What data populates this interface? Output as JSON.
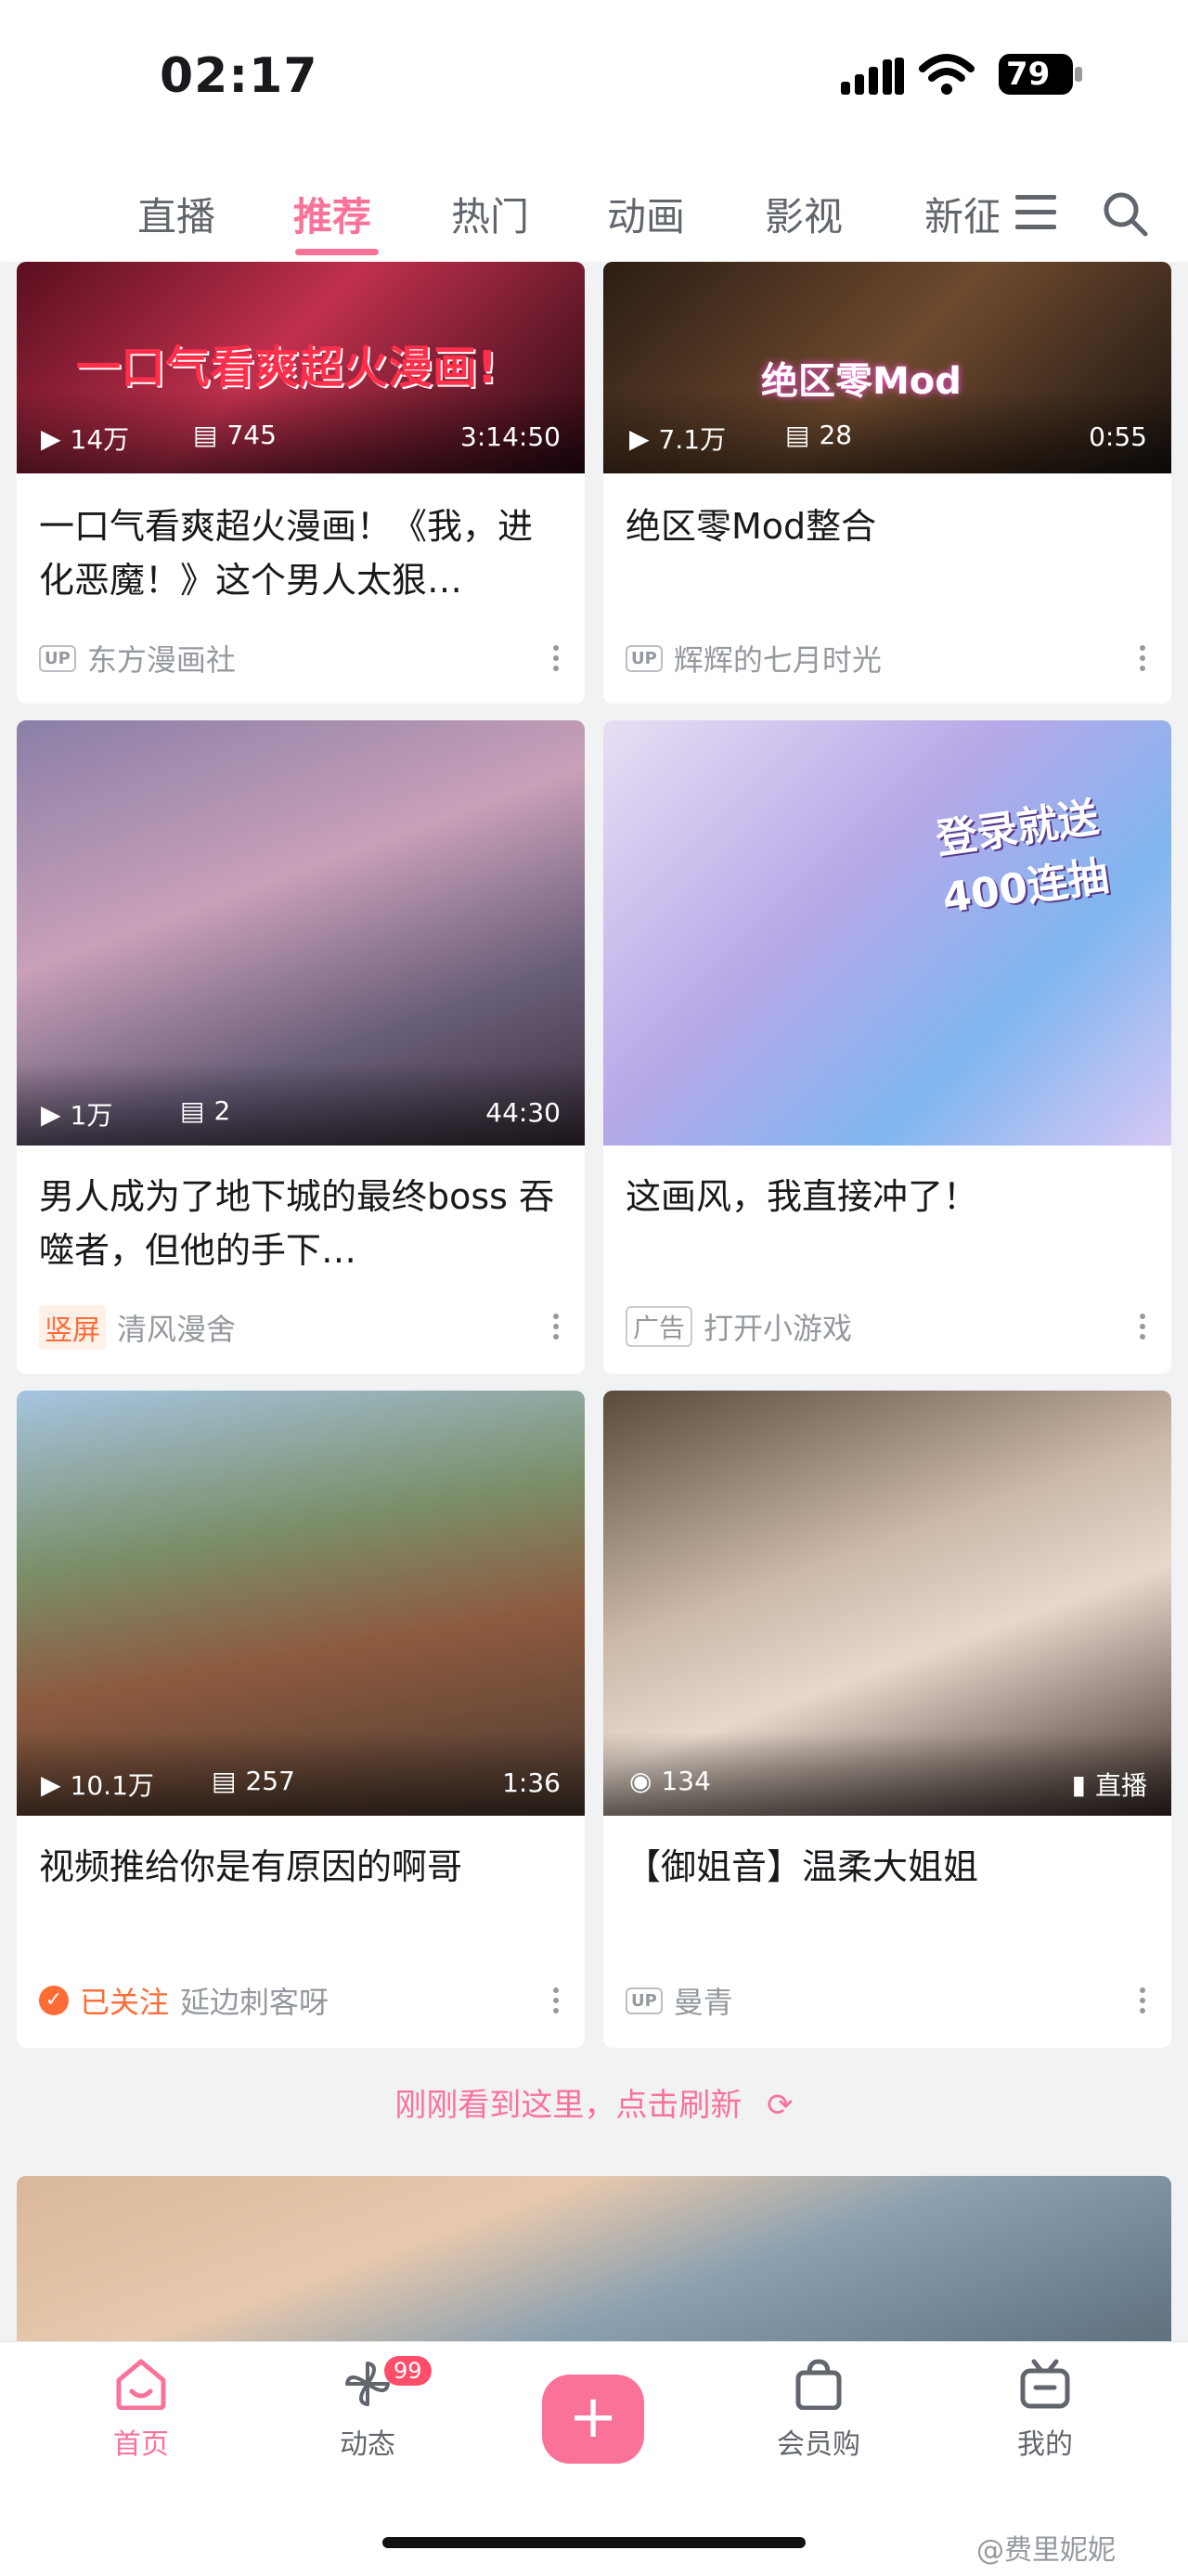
{
  "status": {
    "time": "02:17",
    "battery": "79"
  },
  "tabs": [
    "直播",
    "推荐",
    "热门",
    "动画",
    "影视",
    "新征程"
  ],
  "active_tab": 1,
  "cards": [
    {
      "overlay_text": "一口气看爽超火漫画!",
      "views": "14万",
      "danmaku": "745",
      "duration": "3:14:50",
      "title": "一口气看爽超火漫画！《我，进化恶魔！》这个男人太狠…",
      "badge": "UP",
      "author": "东方漫画社"
    },
    {
      "overlay_text": "绝区零Mod",
      "views": "7.1万",
      "danmaku": "28",
      "duration": "0:55",
      "title": "绝区零Mod整合",
      "badge": "UP",
      "author": "辉辉的七月时光"
    },
    {
      "views": "1万",
      "danmaku": "2",
      "duration": "44:30",
      "title": "男人成为了地下城的最终boss 吞噬者，但他的手下…",
      "badge": "竖屏",
      "author": "清风漫舍"
    },
    {
      "overlay_text": "登录就送 400连抽",
      "title": "这画风，我直接冲了！",
      "badge": "广告",
      "author": "打开小游戏"
    },
    {
      "views": "10.1万",
      "danmaku": "257",
      "duration": "1:36",
      "title": "视频推给你是有原因的啊哥",
      "badge": "已关注",
      "author": "延边刺客呀"
    },
    {
      "views": "134",
      "live_label": "直播",
      "title": "【御姐音】温柔大姐姐",
      "badge": "UP",
      "author": "曼青"
    }
  ],
  "refresh_text": "刚刚看到这里，点击刷新",
  "nav": [
    {
      "label": "首页",
      "icon": "home-icon"
    },
    {
      "label": "动态",
      "icon": "pinwheel-icon",
      "badge": "99"
    },
    {
      "label": "+",
      "icon": "add-icon"
    },
    {
      "label": "会员购",
      "icon": "shopping-bag-icon"
    },
    {
      "label": "我的",
      "icon": "tv-icon"
    }
  ],
  "watermark": "@费里妮妮",
  "colors": {
    "accent": "#fb7299",
    "followed": "#ff6b35"
  }
}
